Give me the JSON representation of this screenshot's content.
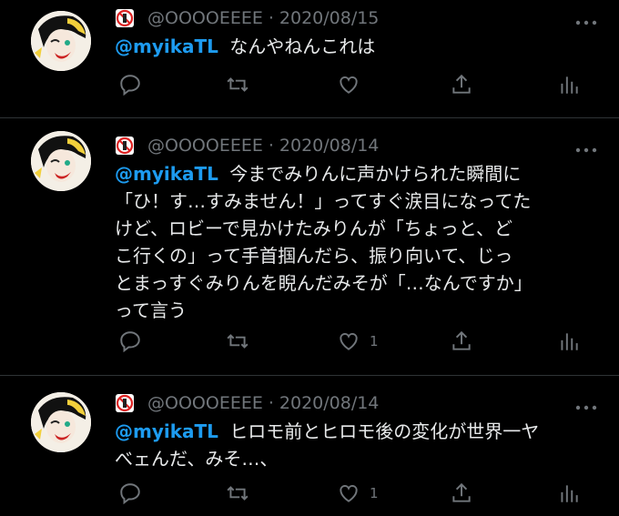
{
  "tweets": [
    {
      "user": "@OOOOEEEE",
      "date": "2020/08/15",
      "mention": "@myikaTL",
      "text": "なんやねんこれは",
      "lines": [],
      "like_count": ""
    },
    {
      "user": "@OOOOEEEE",
      "date": "2020/08/14",
      "mention": "@myikaTL",
      "text": "今までみりんに声かけられた瞬間に",
      "lines": [
        "「ひ！す…すみません！」ってすぐ涙目になってた",
        "けど、ロビーで見かけたみりんが「ちょっと、ど",
        "こ行くの」って手首掴んだら、振り向いて、じっ",
        "とまっすぐみりんを睨んだみそが「…なんですか」",
        "って言う"
      ],
      "like_count": "1"
    },
    {
      "user": "@OOOOEEEE",
      "date": "2020/08/14",
      "mention": "@myikaTL",
      "text": "ヒロモ前とヒロモ後の変化が世界一ヤ",
      "lines": [
        "べェんだ、みそ…、"
      ],
      "like_count": "1"
    }
  ],
  "separator": "·",
  "icons": {
    "name_icon": "no-sign-icon",
    "reply": "reply-icon",
    "retweet": "retweet-icon",
    "like": "like-icon",
    "share": "share-icon",
    "stats": "stats-icon",
    "more": "more-icon"
  },
  "colors": {
    "background": "#000000",
    "text": "#e7e9ea",
    "muted": "#71767b",
    "mention": "#1d9bf0",
    "divider": "#2f3336"
  }
}
